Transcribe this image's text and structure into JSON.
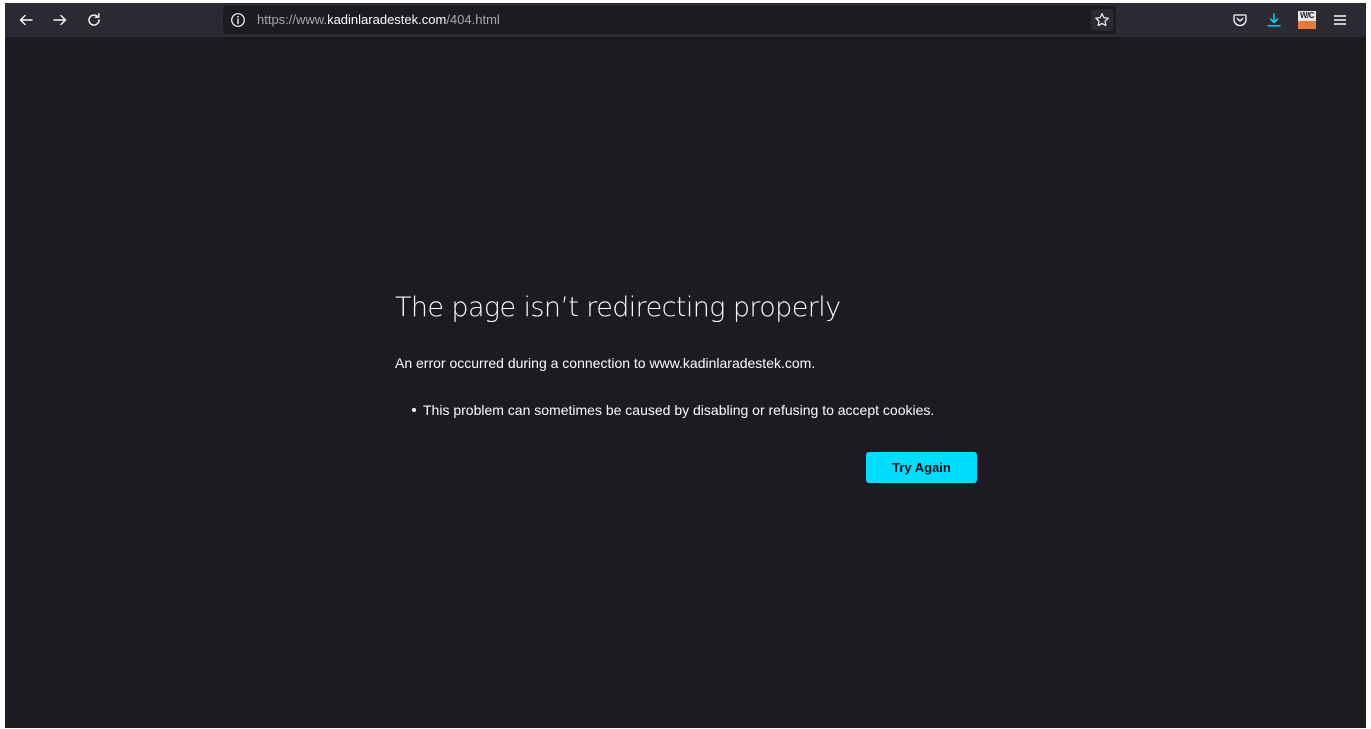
{
  "browser": {
    "url": {
      "prefix": "https://www.",
      "host": "kadinlaradestek.com",
      "path": "/404.html"
    },
    "icons": {
      "back": "back-arrow-icon",
      "forward": "forward-arrow-icon",
      "reload": "reload-icon",
      "site_info": "info-icon",
      "bookmark": "star-icon",
      "pocket": "pocket-icon",
      "downloads": "download-icon",
      "extension": "extension-icon",
      "menu": "hamburger-menu-icon"
    },
    "extension_badge": "W/C",
    "download_color": "#00ddff"
  },
  "error_page": {
    "title": "The page isn’t redirecting properly",
    "description": "An error occurred during a connection to www.kadinlaradestek.com.",
    "reasons": [
      "This problem can sometimes be caused by disabling or refusing to accept cookies."
    ],
    "try_again_label": "Try Again",
    "accent_color": "#00ddff",
    "background_color": "#1c1b22"
  }
}
